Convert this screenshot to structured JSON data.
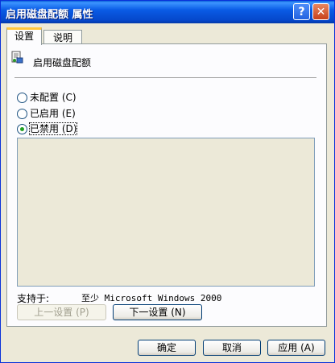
{
  "window": {
    "title": "启用磁盘配额 属性",
    "help_glyph": "?",
    "close_glyph": "✕"
  },
  "tabs": [
    {
      "label": "设置"
    },
    {
      "label": "说明"
    }
  ],
  "policy": {
    "name": "启用磁盘配额"
  },
  "options": [
    {
      "label": "未配置 (C)",
      "checked": false
    },
    {
      "label": "已启用 (E)",
      "checked": false
    },
    {
      "label": "已禁用 (D)",
      "checked": true
    }
  ],
  "support": {
    "label": "支持于:",
    "value": "至少 Microsoft Windows 2000"
  },
  "nav": {
    "prev_label": "上一设置 (P)",
    "next_label": "下一设置 (N)"
  },
  "footer": {
    "ok_label": "确定",
    "cancel_label": "取消",
    "apply_label": "应用 (A)"
  },
  "colors": {
    "titlebar": "#0a5ce6",
    "face": "#ece9d8",
    "tab_highlight": "#ffc73c",
    "radio_dot": "#21a121"
  }
}
